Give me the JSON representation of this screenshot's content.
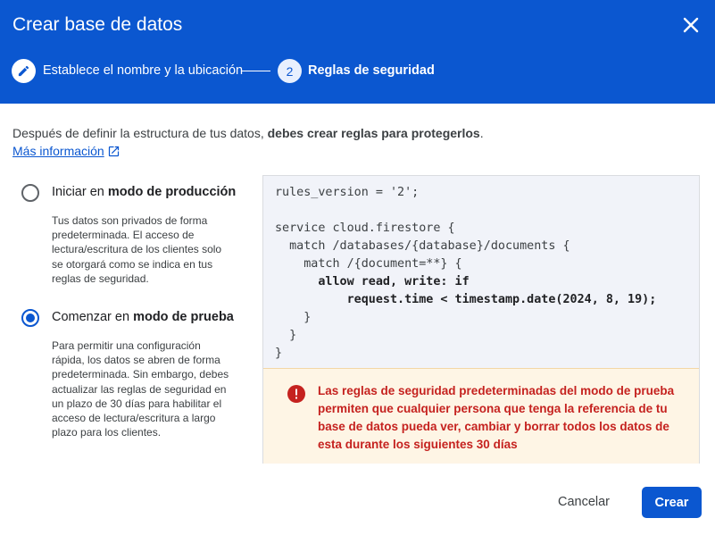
{
  "dialog": {
    "title": "Crear base de datos",
    "close_icon": "close-icon",
    "accent_color": "#0b57d0"
  },
  "stepper": {
    "step1": {
      "icon": "edit-pencil-icon",
      "label": "Establece el nombre y la ubicación"
    },
    "step2": {
      "number": "2",
      "label": "Reglas de seguridad"
    }
  },
  "intro": {
    "text_before": "Después de definir la estructura de tus datos, ",
    "text_bold": "debes crear reglas para protegerlos",
    "text_after": ".",
    "link_label": "Más información",
    "link_icon": "open-in-new-icon"
  },
  "options": {
    "production": {
      "label_prefix": "Iniciar en ",
      "label_bold": "modo de producción",
      "selected": false,
      "description": "Tus datos son privados de forma predeterminada. El acceso de lectura/escritura de los clientes solo se otorgará como se indica en tus reglas de seguridad."
    },
    "test": {
      "label_prefix": "Comenzar en ",
      "label_bold": "modo de prueba",
      "selected": true,
      "description": "Para permitir una configuración rápida, los datos se abren de forma predeterminada. Sin embargo, debes actualizar las reglas de seguridad en un plazo de 30 días para habilitar el acceso de lectura/escritura a largo plazo para los clientes."
    }
  },
  "rules_code": {
    "line1": "rules_version = '2';",
    "line2": "service cloud.firestore {",
    "line3": "  match /databases/{database}/documents {",
    "line4": "    match /{document=**} {",
    "line5": "      allow read, write: if",
    "line6": "          request.time < timestamp.date(2024, 8, 19);",
    "line7": "    }",
    "line8": "  }",
    "line9": "}"
  },
  "warning": {
    "icon": "error-icon",
    "text": "Las reglas de seguridad predeterminadas del modo de prueba permiten que cualquier persona que tenga la referencia de tu base de datos pueda ver, cambiar y borrar todos los datos de esta durante los siguientes 30 días"
  },
  "actions": {
    "cancel_label": "Cancelar",
    "create_label": "Crear"
  }
}
